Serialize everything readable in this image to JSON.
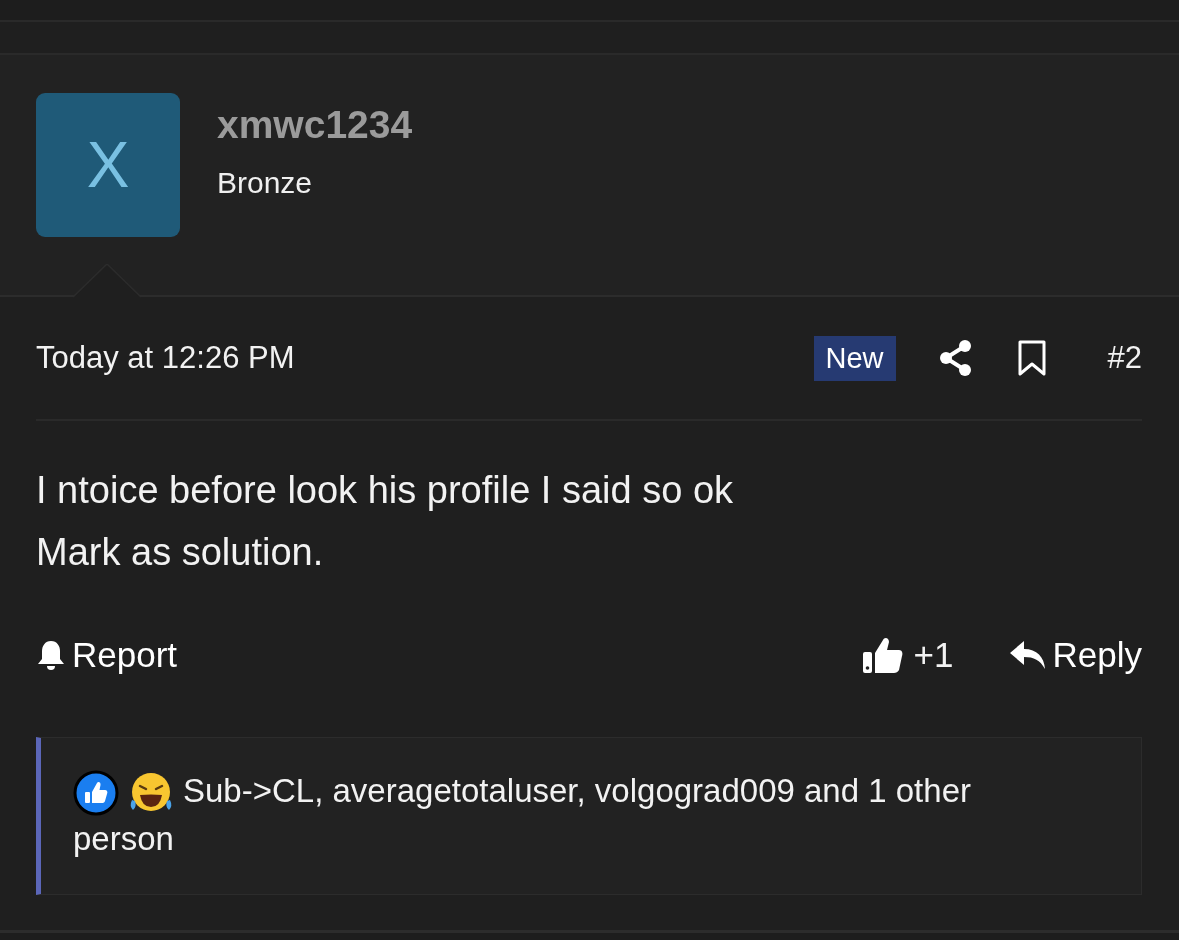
{
  "user": {
    "avatar_letter": "X",
    "name": "xmwc1234",
    "title": "Bronze"
  },
  "post": {
    "time": "Today at 12:26 PM",
    "badge": "New",
    "number": "#2",
    "body": [
      "I ntoice before look his profile I said so ok",
      "Mark as solution."
    ],
    "actions": {
      "report": "Report",
      "like_count": "+1",
      "reply": "Reply"
    },
    "reactions": {
      "icons": [
        {
          "kind": "like"
        },
        {
          "kind": "laugh"
        }
      ],
      "text": "Sub->CL, averagetotaluser, volgograd009 and 1 other person"
    }
  }
}
